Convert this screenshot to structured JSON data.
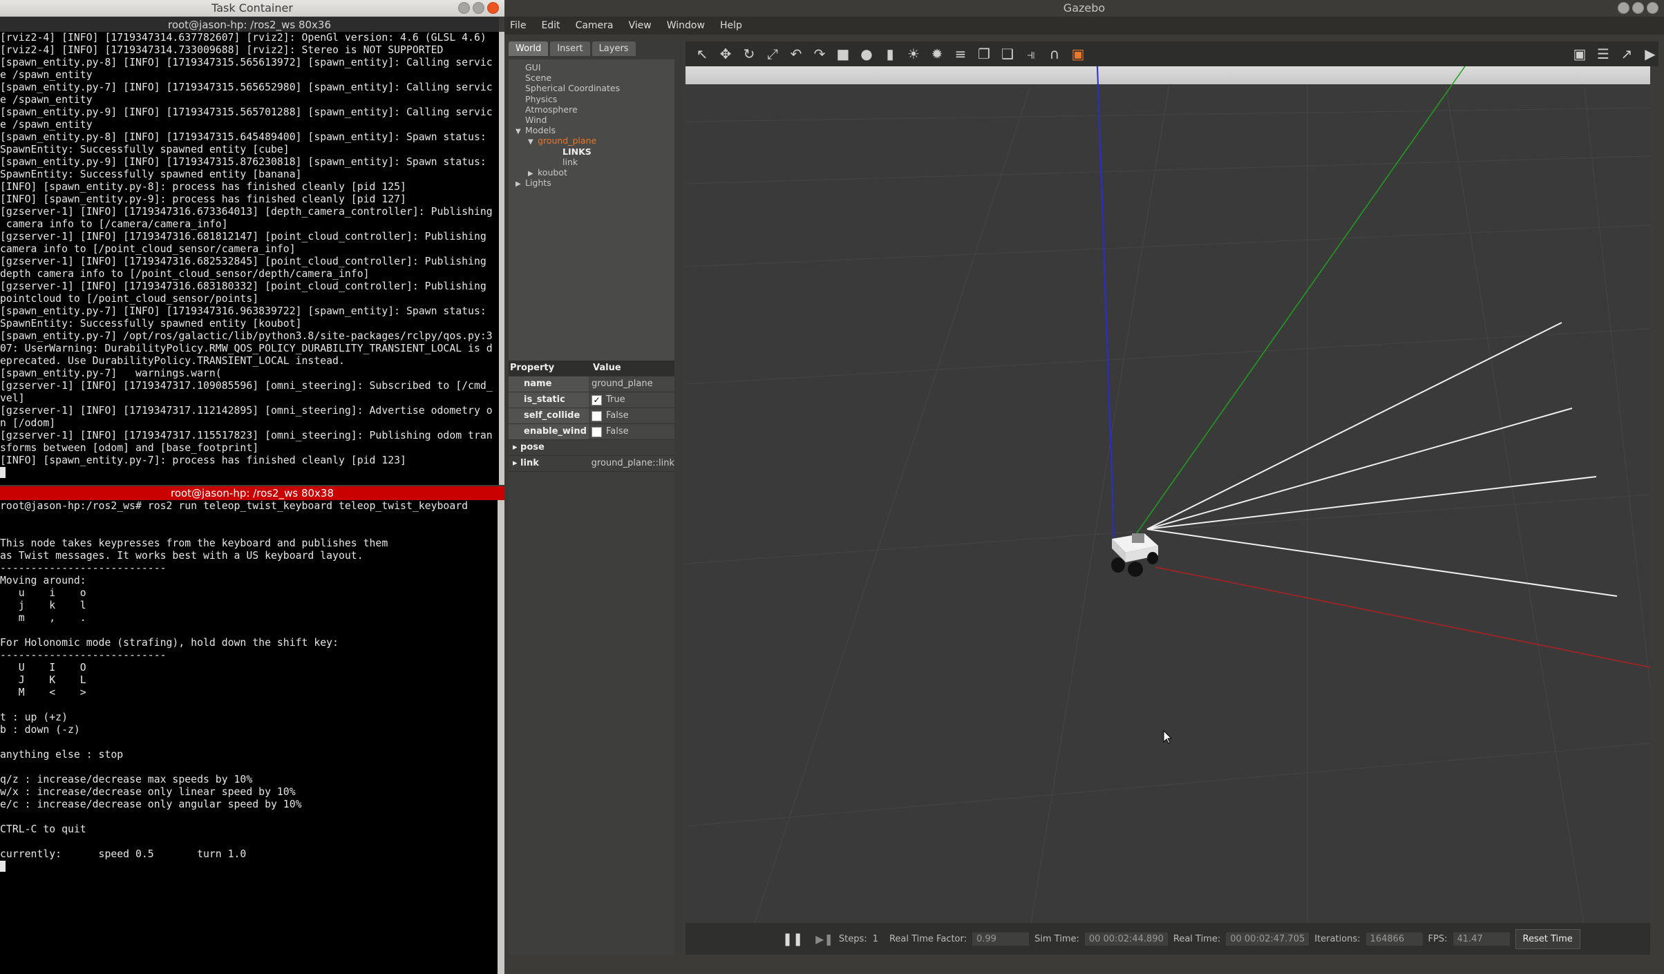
{
  "left_window": {
    "title": "Task Container",
    "top_term": {
      "title": "root@jason-hp: /ros2_ws 80x36",
      "lines": [
        "[rviz2-4] [INFO] [1719347314.637782607] [rviz2]: OpenGl version: 4.6 (GLSL 4.6)",
        "[rviz2-4] [INFO] [1719347314.733009688] [rviz2]: Stereo is NOT SUPPORTED",
        "[spawn_entity.py-8] [INFO] [1719347315.565613972] [spawn_entity]: Calling servic",
        "e /spawn_entity",
        "[spawn_entity.py-7] [INFO] [1719347315.565652980] [spawn_entity]: Calling servic",
        "e /spawn_entity",
        "[spawn_entity.py-9] [INFO] [1719347315.565701288] [spawn_entity]: Calling servic",
        "e /spawn_entity",
        "[spawn_entity.py-8] [INFO] [1719347315.645489400] [spawn_entity]: Spawn status:",
        "SpawnEntity: Successfully spawned entity [cube]",
        "[spawn_entity.py-9] [INFO] [1719347315.876230818] [spawn_entity]: Spawn status:",
        "SpawnEntity: Successfully spawned entity [banana]",
        "[INFO] [spawn_entity.py-8]: process has finished cleanly [pid 125]",
        "[INFO] [spawn_entity.py-9]: process has finished cleanly [pid 127]",
        "[gzserver-1] [INFO] [1719347316.673364013] [depth_camera_controller]: Publishing",
        " camera info to [/camera/camera_info]",
        "[gzserver-1] [INFO] [1719347316.681812147] [point_cloud_controller]: Publishing",
        "camera info to [/point_cloud_sensor/camera_info]",
        "[gzserver-1] [INFO] [1719347316.682532845] [point_cloud_controller]: Publishing",
        "depth camera info to [/point_cloud_sensor/depth/camera_info]",
        "[gzserver-1] [INFO] [1719347316.683180332] [point_cloud_controller]: Publishing",
        "pointcloud to [/point_cloud_sensor/points]",
        "[spawn_entity.py-7] [INFO] [1719347316.963839722] [spawn_entity]: Spawn status:",
        "SpawnEntity: Successfully spawned entity [koubot]",
        "[spawn_entity.py-7] /opt/ros/galactic/lib/python3.8/site-packages/rclpy/qos.py:3",
        "07: UserWarning: DurabilityPolicy.RMW_QOS_POLICY_DURABILITY_TRANSIENT_LOCAL is d",
        "eprecated. Use DurabilityPolicy.TRANSIENT_LOCAL instead.",
        "[spawn_entity.py-7]   warnings.warn(",
        "[gzserver-1] [INFO] [1719347317.109085596] [omni_steering]: Subscribed to [/cmd_",
        "vel]",
        "[gzserver-1] [INFO] [1719347317.112142895] [omni_steering]: Advertise odometry o",
        "n [/odom]",
        "[gzserver-1] [INFO] [1719347317.115517823] [omni_steering]: Publishing odom tran",
        "sforms between [odom] and [base_footprint]",
        "[INFO] [spawn_entity.py-7]: process has finished cleanly [pid 123]"
      ]
    },
    "bottom_term": {
      "title": "root@jason-hp: /ros2_ws 80x38",
      "lines": [
        "root@jason-hp:/ros2_ws# ros2 run teleop_twist_keyboard teleop_twist_keyboard",
        "",
        "",
        "This node takes keypresses from the keyboard and publishes them",
        "as Twist messages. It works best with a US keyboard layout.",
        "---------------------------",
        "Moving around:",
        "   u    i    o",
        "   j    k    l",
        "   m    ,    .",
        "",
        "For Holonomic mode (strafing), hold down the shift key:",
        "---------------------------",
        "   U    I    O",
        "   J    K    L",
        "   M    <    >",
        "",
        "t : up (+z)",
        "b : down (-z)",
        "",
        "anything else : stop",
        "",
        "q/z : increase/decrease max speeds by 10%",
        "w/x : increase/decrease only linear speed by 10%",
        "e/c : increase/decrease only angular speed by 10%",
        "",
        "CTRL-C to quit",
        "",
        "currently:      speed 0.5       turn 1.0"
      ]
    }
  },
  "gazebo": {
    "title": "Gazebo",
    "menu": [
      "File",
      "Edit",
      "Camera",
      "View",
      "Window",
      "Help"
    ],
    "tabs": [
      "World",
      "Insert",
      "Layers"
    ],
    "tree": [
      {
        "label": "GUI",
        "indent": 0,
        "arrow": ""
      },
      {
        "label": "Scene",
        "indent": 0,
        "arrow": ""
      },
      {
        "label": "Spherical Coordinates",
        "indent": 0,
        "arrow": ""
      },
      {
        "label": "Physics",
        "indent": 0,
        "arrow": ""
      },
      {
        "label": "Atmosphere",
        "indent": 0,
        "arrow": ""
      },
      {
        "label": "Wind",
        "indent": 0,
        "arrow": ""
      },
      {
        "label": "Models",
        "indent": 0,
        "arrow": "down"
      },
      {
        "label": "ground_plane",
        "indent": 1,
        "arrow": "down",
        "highlight": true
      },
      {
        "label": "LINKS",
        "indent": 3,
        "arrow": "",
        "bold": true
      },
      {
        "label": "link",
        "indent": 3,
        "arrow": ""
      },
      {
        "label": "koubot",
        "indent": 1,
        "arrow": "right"
      },
      {
        "label": "Lights",
        "indent": 0,
        "arrow": "right"
      }
    ],
    "props_header": {
      "property": "Property",
      "value": "Value"
    },
    "props": [
      {
        "name": "name",
        "value": "ground_plane",
        "checkbox": false
      },
      {
        "name": "is_static",
        "value": "True",
        "checkbox": true,
        "checked": true
      },
      {
        "name": "self_collide",
        "value": "False",
        "checkbox": true,
        "checked": false
      },
      {
        "name": "enable_wind",
        "value": "False",
        "checkbox": true,
        "checked": false
      },
      {
        "name": "pose",
        "value": "",
        "expand": true
      },
      {
        "name": "link",
        "value": "ground_plane::link",
        "expand": true
      }
    ],
    "status": {
      "steps_label": "Steps:",
      "steps_value": "1",
      "rtf_label": "Real Time Factor:",
      "rtf_value": "0.99",
      "sim_label": "Sim Time:",
      "sim_value": "00 00:02:44.890",
      "real_label": "Real Time:",
      "real_value": "00 00:02:47.705",
      "iter_label": "Iterations:",
      "iter_value": "164866",
      "fps_label": "FPS:",
      "fps_value": "41.47",
      "reset_label": "Reset Time"
    }
  }
}
